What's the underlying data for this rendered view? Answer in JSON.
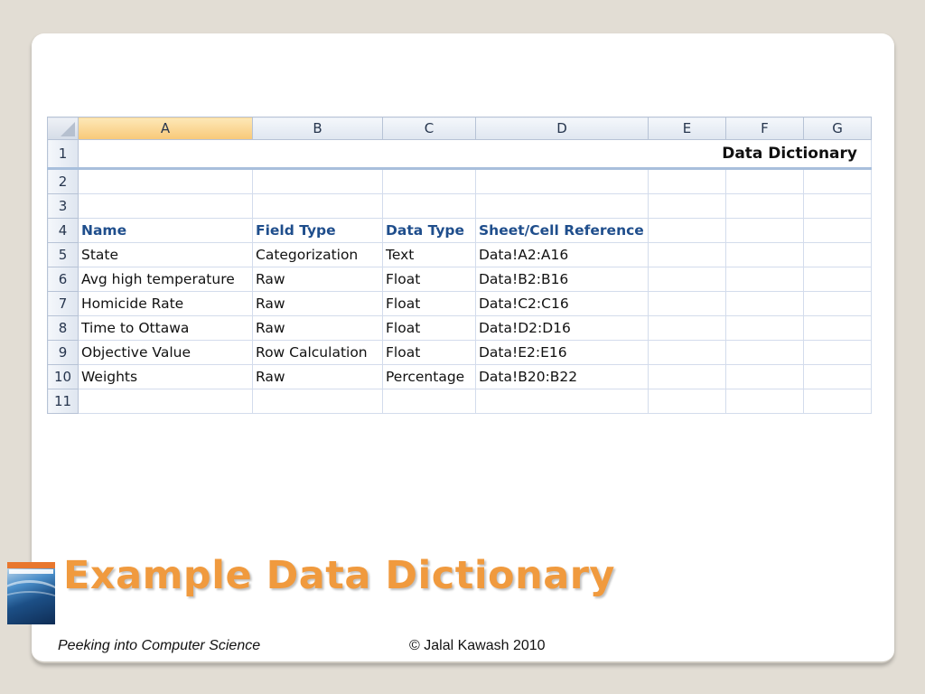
{
  "sheet": {
    "columns": [
      "A",
      "B",
      "C",
      "D",
      "E",
      "F",
      "G"
    ],
    "row_numbers": [
      "1",
      "2",
      "3",
      "4",
      "5",
      "6",
      "7",
      "8",
      "9",
      "10",
      "11"
    ],
    "banner": "Data Dictionary",
    "headers": [
      "Name",
      "Field Type",
      "Data Type",
      "Sheet/Cell Reference"
    ],
    "rows": [
      [
        "State",
        "Categorization",
        "Text",
        "Data!A2:A16"
      ],
      [
        "Avg high temperature",
        "Raw",
        "Float",
        "Data!B2:B16"
      ],
      [
        "Homicide Rate",
        "Raw",
        "Float",
        "Data!C2:C16"
      ],
      [
        "Time to Ottawa",
        "Raw",
        "Float",
        "Data!D2:D16"
      ],
      [
        "Objective Value",
        "Row Calculation",
        "Float",
        "Data!E2:E16"
      ],
      [
        "Weights",
        "Raw",
        "Percentage",
        "Data!B20:B22"
      ]
    ]
  },
  "slide": {
    "title": "Example Data Dictionary",
    "footer_left": "Peeking into Computer Science",
    "footer_right": "© Jalal Kawash 2010"
  },
  "colors": {
    "title": "#f09a3e",
    "header_text": "#1f4e8c",
    "selected_column": "#f8c878"
  },
  "icons": [
    "book-cover-icon"
  ]
}
